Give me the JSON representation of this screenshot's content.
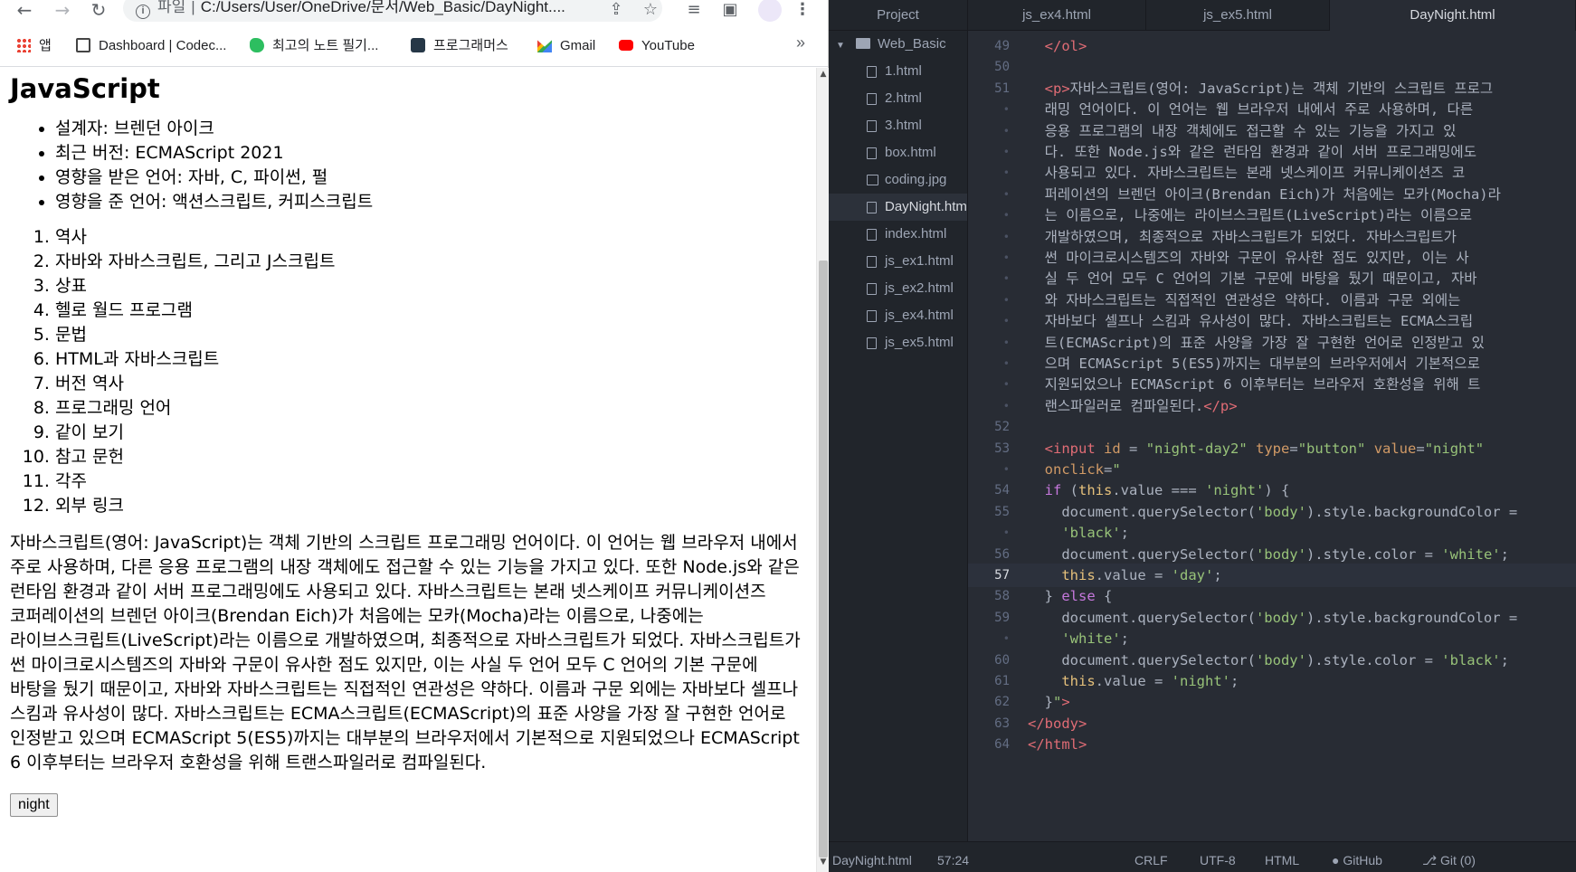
{
  "browser": {
    "omnibox": {
      "scheme": "파일",
      "url": "C:/Users/User/OneDrive/문서/Web_Basic/DayNight...."
    },
    "bookmarks": [
      {
        "icon": "apps-icon",
        "label": "앱"
      },
      {
        "icon": "codecademy-icon",
        "label": "Dashboard | Codec..."
      },
      {
        "icon": "evernote-icon",
        "label": "최고의 노트 필기..."
      },
      {
        "icon": "programmers-icon",
        "label": "프로그래머스"
      },
      {
        "icon": "gmail-icon",
        "label": "Gmail"
      },
      {
        "icon": "youtube-icon",
        "label": "YouTube"
      }
    ],
    "more": "»"
  },
  "page": {
    "title": "JavaScript",
    "facts": [
      "설계자: 브렌던 아이크",
      "최근 버전: ECMAScript 2021",
      "영향을 받은 언어: 자바, C, 파이썬, 펄",
      "영향을 준 언어: 액션스크립트, 커피스크립트"
    ],
    "toc": [
      "역사",
      "자바와 자바스크립트, 그리고 J스크립트",
      "상표",
      "헬로 월드 프로그램",
      "문법",
      "HTML과 자바스크립트",
      "버전 역사",
      "프로그래밍 언어",
      "같이 보기",
      "참고 문헌",
      "각주",
      "외부 링크"
    ],
    "paragraph": "자바스크립트(영어: JavaScript)는 객체 기반의 스크립트 프로그래밍 언어이다. 이 언어는 웹 브라우저 내에서 주로 사용하며, 다른 응용 프로그램의 내장 객체에도 접근할 수 있는 기능을 가지고 있다. 또한 Node.js와 같은 런타임 환경과 같이 서버 프로그래밍에도 사용되고 있다. 자바스크립트는 본래 넷스케이프 커뮤니케이션즈 코퍼레이션의 브렌던 아이크(Brendan Eich)가 처음에는 모카(Mocha)라는 이름으로, 나중에는 라이브스크립트(LiveScript)라는 이름으로 개발하였으며, 최종적으로 자바스크립트가 되었다. 자바스크립트가 썬 마이크로시스템즈의 자바와 구문이 유사한 점도 있지만, 이는 사실 두 언어 모두 C 언어의 기본 구문에 바탕을 뒀기 때문이고, 자바와 자바스크립트는 직접적인 연관성은 약하다. 이름과 구문 외에는 자바보다 셀프나 스킴과 유사성이 많다. 자바스크립트는 ECMA스크립트(ECMAScript)의 표준 사양을 가장 잘 구현한 언어로 인정받고 있으며 ECMAScript 5(ES5)까지는 대부분의 브라우저에서 기본적으로 지원되었으나 ECMAScript 6 이후부터는 브라우저 호환성을 위해 트랜스파일러로 컴파일된다.",
    "button": "night"
  },
  "editor": {
    "tabs": [
      "Project",
      "js_ex4.html",
      "js_ex5.html",
      "DayNight.html"
    ],
    "active_tab": "DayNight.html",
    "tree": {
      "root": "Web_Basic",
      "files": [
        {
          "name": "1.html",
          "type": "file"
        },
        {
          "name": "2.html",
          "type": "file"
        },
        {
          "name": "3.html",
          "type": "file"
        },
        {
          "name": "box.html",
          "type": "file"
        },
        {
          "name": "coding.jpg",
          "type": "image"
        },
        {
          "name": "DayNight.htm",
          "type": "file",
          "selected": true
        },
        {
          "name": "index.html",
          "type": "file"
        },
        {
          "name": "js_ex1.html",
          "type": "file"
        },
        {
          "name": "js_ex2.html",
          "type": "file"
        },
        {
          "name": "js_ex4.html",
          "type": "file"
        },
        {
          "name": "js_ex5.html",
          "type": "file"
        }
      ]
    },
    "code_lines": [
      {
        "n": "49",
        "html": "  <span class=\"tg\">&lt;/ol&gt;</span>"
      },
      {
        "n": "50",
        "html": ""
      },
      {
        "n": "51",
        "html": "  <span class=\"tg\">&lt;p&gt;</span>자바스크립트(영어: JavaScript)는 객체 기반의 스크립트 프로그"
      },
      {
        "n": "•",
        "html": "  래밍 언어이다. 이 언어는 웹 브라우저 내에서 주로 사용하며, 다른"
      },
      {
        "n": "•",
        "html": "  응용 프로그램의 내장 객체에도 접근할 수 있는 기능을 가지고 있"
      },
      {
        "n": "•",
        "html": "  다. 또한 Node.js와 같은 런타임 환경과 같이 서버 프로그래밍에도"
      },
      {
        "n": "•",
        "html": "  사용되고 있다. 자바스크립트는 본래 넷스케이프 커뮤니케이션즈 코"
      },
      {
        "n": "•",
        "html": "  퍼레이션의 브렌던 아이크(Brendan Eich)가 처음에는 모카(Mocha)라"
      },
      {
        "n": "•",
        "html": "  는 이름으로, 나중에는 라이브스크립트(LiveScript)라는 이름으로"
      },
      {
        "n": "•",
        "html": "  개발하였으며, 최종적으로 자바스크립트가 되었다. 자바스크립트가"
      },
      {
        "n": "•",
        "html": "  썬 마이크로시스템즈의 자바와 구문이 유사한 점도 있지만, 이는 사"
      },
      {
        "n": "•",
        "html": "  실 두 언어 모두 C 언어의 기본 구문에 바탕을 뒀기 때문이고, 자바"
      },
      {
        "n": "•",
        "html": "  와 자바스크립트는 직접적인 연관성은 약하다. 이름과 구문 외에는"
      },
      {
        "n": "•",
        "html": "  자바보다 셀프나 스킴과 유사성이 많다. 자바스크립트는 ECMA스크립"
      },
      {
        "n": "•",
        "html": "  트(ECMAScript)의 표준 사양을 가장 잘 구현한 언어로 인정받고 있"
      },
      {
        "n": "•",
        "html": "  으며 ECMAScript 5(ES5)까지는 대부분의 브라우저에서 기본적으로"
      },
      {
        "n": "•",
        "html": "  지원되었으나 ECMAScript 6 이후부터는 브라우저 호환성을 위해 트"
      },
      {
        "n": "•",
        "html": "  랜스파일러로 컴파일된다.<span class=\"tg\">&lt;/p&gt;</span>"
      },
      {
        "n": "52",
        "html": ""
      },
      {
        "n": "53",
        "html": "  <span class=\"tg\">&lt;input</span> <span class=\"at\">id</span> = <span class=\"st\">\"night-day2\"</span> <span class=\"at\">type</span>=<span class=\"st\">\"button\"</span> <span class=\"at\">value</span>=<span class=\"st\">\"night\"</span>"
      },
      {
        "n": "•",
        "html": "  <span class=\"at\">onclick</span>=<span class=\"st\">\"</span>"
      },
      {
        "n": "54",
        "html": "  <span class=\"kw\">if</span> (<span class=\"vr\">this</span>.value === <span class=\"st\">'night'</span>) {"
      },
      {
        "n": "55",
        "html": "    document.querySelector(<span class=\"st\">'body'</span>).style.backgroundColor ="
      },
      {
        "n": "•",
        "html": "    <span class=\"st\">'black'</span>;"
      },
      {
        "n": "56",
        "html": "    document.querySelector(<span class=\"st\">'body'</span>).style.color = <span class=\"st\">'white'</span>;"
      },
      {
        "n": "57",
        "html": "    <span class=\"vr\">this</span>.value = <span class=\"st\">'day'</span>;",
        "current": true
      },
      {
        "n": "58",
        "html": "  } <span class=\"kw\">else</span> {"
      },
      {
        "n": "59",
        "html": "    document.querySelector(<span class=\"st\">'body'</span>).style.backgroundColor ="
      },
      {
        "n": "•",
        "html": "    <span class=\"st\">'white'</span>;"
      },
      {
        "n": "60",
        "html": "    document.querySelector(<span class=\"st\">'body'</span>).style.color = <span class=\"st\">'black'</span>;"
      },
      {
        "n": "61",
        "html": "    <span class=\"vr\">this</span>.value = <span class=\"st\">'night'</span>;"
      },
      {
        "n": "62",
        "html": "  }<span class=\"st\">\"</span><span class=\"tg\">&gt;</span>"
      },
      {
        "n": "63",
        "html": "<span class=\"tg\">&lt;/body&gt;</span>"
      },
      {
        "n": "64",
        "html": "<span class=\"tg\">&lt;/html&gt;</span>"
      }
    ],
    "status": {
      "file": "DayNight.html",
      "cursor": "57:24",
      "line_ending": "CRLF",
      "encoding": "UTF-8",
      "grammar": "HTML",
      "github": "GitHub",
      "git": "Git (0)"
    }
  }
}
